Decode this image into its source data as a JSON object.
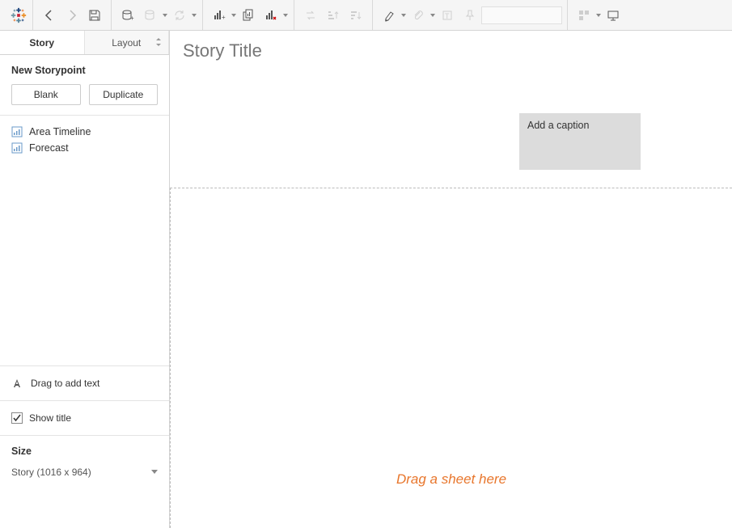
{
  "toolbar": {
    "logo_alt": "tableau-logo"
  },
  "sidebar": {
    "tabs": {
      "story": "Story",
      "layout": "Layout"
    },
    "newStorypoint": {
      "title": "New Storypoint",
      "blank": "Blank",
      "duplicate": "Duplicate"
    },
    "sheets": [
      {
        "label": "Area Timeline"
      },
      {
        "label": "Forecast"
      }
    ],
    "dragText": "Drag to add text",
    "showTitle": "Show title",
    "size": {
      "title": "Size",
      "value": "Story (1016 x 964)"
    }
  },
  "canvas": {
    "title": "Story Title",
    "caption": "Add a caption",
    "dropHint": "Drag a sheet here"
  }
}
